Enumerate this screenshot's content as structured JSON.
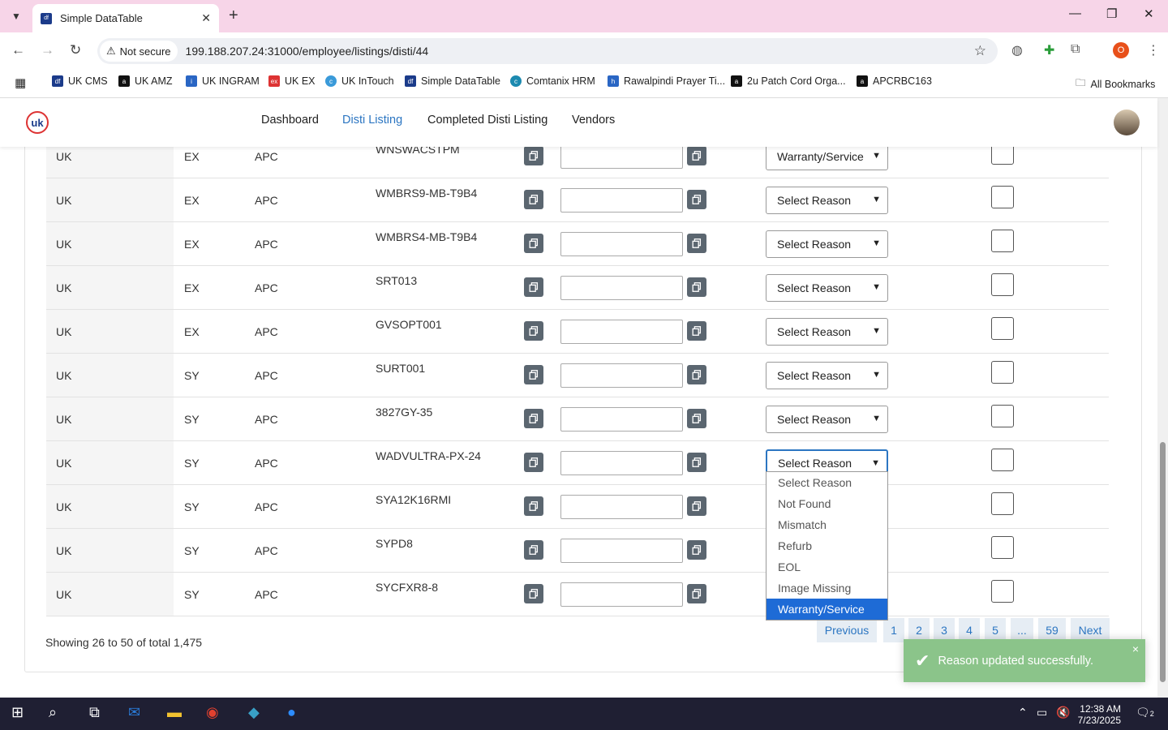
{
  "browser": {
    "tab_title": "Simple DataTable",
    "security_label": "Not secure",
    "url": "199.188.207.24:31000/employee/listings/disti/44",
    "profile_initial": "O",
    "bookmarks": [
      "UK CMS",
      "UK AMZ",
      "UK INGRAM",
      "UK EX",
      "UK InTouch",
      "Simple DataTable",
      "Comtanix HRM",
      "Rawalpindi Prayer Ti...",
      "2u Patch Cord Orga...",
      "APCRBC163"
    ],
    "all_bookmarks": "All Bookmarks"
  },
  "nav": {
    "items": [
      "Dashboard",
      "Disti Listing",
      "Completed Disti Listing",
      "Vendors"
    ],
    "active": "Disti Listing"
  },
  "table": {
    "rows": [
      {
        "region": "UK",
        "code": "EX",
        "vendor": "APC",
        "sku": "WNSWACSTPM",
        "reason": "Warranty/Service"
      },
      {
        "region": "UK",
        "code": "EX",
        "vendor": "APC",
        "sku": "WMBRS9-MB-T9B4",
        "reason": "Select Reason"
      },
      {
        "region": "UK",
        "code": "EX",
        "vendor": "APC",
        "sku": "WMBRS4-MB-T9B4",
        "reason": "Select Reason"
      },
      {
        "region": "UK",
        "code": "EX",
        "vendor": "APC",
        "sku": "SRT013",
        "reason": "Select Reason"
      },
      {
        "region": "UK",
        "code": "EX",
        "vendor": "APC",
        "sku": "GVSOPT001",
        "reason": "Select Reason"
      },
      {
        "region": "UK",
        "code": "SY",
        "vendor": "APC",
        "sku": "SURT001",
        "reason": "Select Reason"
      },
      {
        "region": "UK",
        "code": "SY",
        "vendor": "APC",
        "sku": "3827GY-35",
        "reason": "Select Reason"
      },
      {
        "region": "UK",
        "code": "SY",
        "vendor": "APC",
        "sku": "WADVULTRA-PX-24",
        "reason": "Select Reason"
      },
      {
        "region": "UK",
        "code": "SY",
        "vendor": "APC",
        "sku": "SYA12K16RMI",
        "reason": ""
      },
      {
        "region": "UK",
        "code": "SY",
        "vendor": "APC",
        "sku": "SYPD8",
        "reason": ""
      },
      {
        "region": "UK",
        "code": "SY",
        "vendor": "APC",
        "sku": "SYCFXR8-8",
        "reason": ""
      }
    ]
  },
  "dropdown": {
    "options": [
      "Select Reason",
      "Not Found",
      "Mismatch",
      "Refurb",
      "EOL",
      "Image Missing",
      "Warranty/Service"
    ],
    "highlighted": "Warranty/Service"
  },
  "footer": {
    "showing": "Showing 26 to 50 of total 1,475",
    "pages": [
      "Previous",
      "1",
      "2",
      "3",
      "4",
      "5",
      "...",
      "59",
      "Next"
    ]
  },
  "toast": {
    "message": "Reason updated successfully.",
    "close": "×"
  },
  "taskbar": {
    "time": "12:38 AM",
    "date": "7/23/2025",
    "notif_count": "2"
  }
}
